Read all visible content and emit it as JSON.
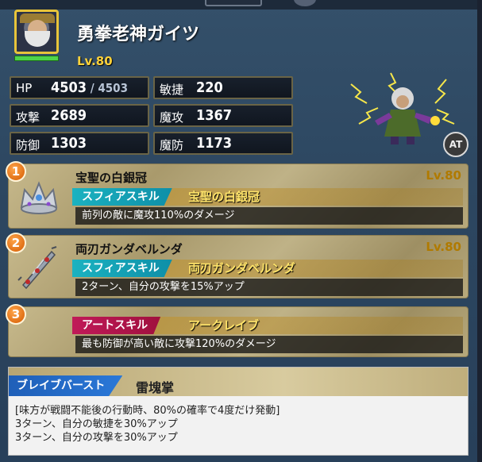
{
  "character": {
    "name": "勇拳老神ガイツ",
    "level": "Lv.80"
  },
  "stats": {
    "hp_label": "HP",
    "hp_value": "4503",
    "hp_max": " / 4503",
    "agi_label": "敏捷",
    "agi_value": "220",
    "atk_label": "攻撃",
    "atk_value": "2689",
    "matk_label": "魔攻",
    "matk_value": "1367",
    "def_label": "防御",
    "def_value": "1303",
    "mdef_label": "魔防",
    "mdef_value": "1173"
  },
  "at_badge": "AT",
  "skills": [
    {
      "number": "1",
      "title": "宝聖の白銀冠",
      "level": "Lv.80",
      "type": "スフィアスキル",
      "skill_name": "宝聖の白銀冠",
      "description": "前列の敵に魔攻110%のダメージ",
      "icon": "silver-crown-icon"
    },
    {
      "number": "2",
      "title": "両刃ガンダベルンダ",
      "level": "Lv.80",
      "type": "スフィアスキル",
      "skill_name": "両刃ガンダベルンダ",
      "description": "2ターン、自分の攻撃を15%アップ",
      "icon": "double-blade-icon"
    },
    {
      "number": "3",
      "type": "アートスキル",
      "skill_name": "アークレイブ",
      "description": "最も防御が高い敵に攻撃120%のダメージ"
    }
  ],
  "brave_burst": {
    "label": "ブレイブバースト",
    "name": "雷塊掌",
    "lines": [
      "[味方が戦闘不能後の行動時、80%の確率で4度だけ発動]",
      "3ターン、自分の敏捷を30%アップ",
      "3ターン、自分の攻撃を30%アップ"
    ]
  },
  "colors": {
    "accent_gold": "#ffd23a",
    "sphere_skill": "#1bb2c0",
    "art_skill": "#c01a58",
    "brave_burst": "#1f5fb8",
    "number_badge": "#e9731a"
  }
}
